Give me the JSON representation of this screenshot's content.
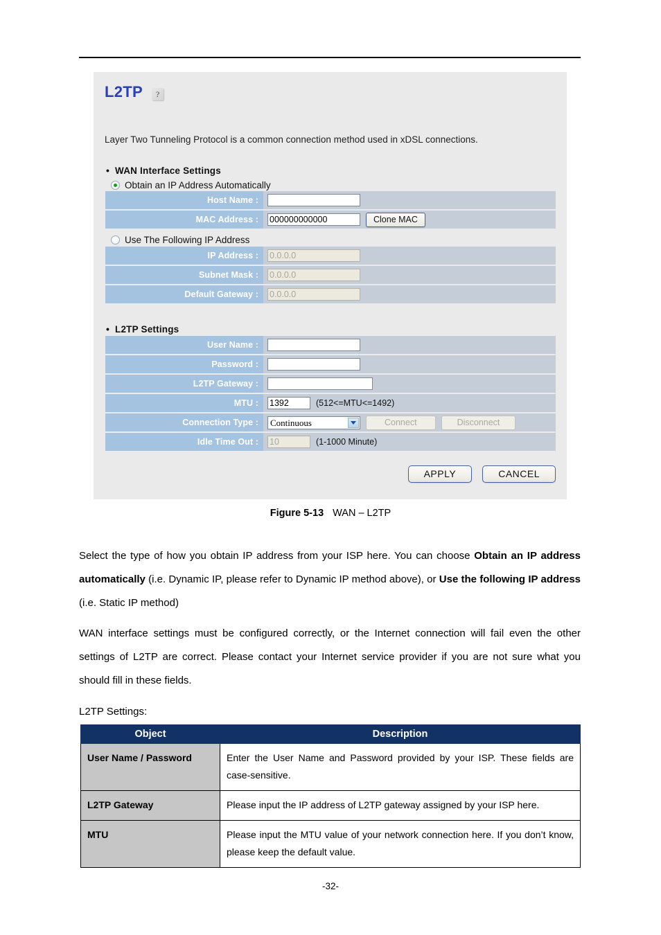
{
  "page": {
    "number": "-32-"
  },
  "screenshot": {
    "title": "L2TP",
    "help_icon": "?",
    "description": "Layer Two Tunneling Protocol is a common connection method used in xDSL connections.",
    "sections": {
      "wan": {
        "heading": "WAN Interface Settings",
        "radio_auto": "Obtain an IP Address Automatically",
        "radio_static": "Use The Following IP Address",
        "fields": [
          {
            "label": "Host Name :",
            "value": ""
          },
          {
            "label": "MAC Address :",
            "value": "000000000000",
            "button": "Clone MAC"
          },
          {
            "label": "IP Address :",
            "value": "0.0.0.0"
          },
          {
            "label": "Subnet Mask :",
            "value": "0.0.0.0"
          },
          {
            "label": "Default Gateway :",
            "value": "0.0.0.0"
          }
        ]
      },
      "l2tp": {
        "heading": "L2TP Settings",
        "fields": [
          {
            "label": "User Name :",
            "value": ""
          },
          {
            "label": "Password :",
            "value": ""
          },
          {
            "label": "L2TP Gateway :",
            "value": ""
          },
          {
            "label": "MTU :",
            "value": "1392",
            "hint": "(512<=MTU<=1492)"
          },
          {
            "label": "Connection Type :",
            "value": "Continuous",
            "btn_connect": "Connect",
            "btn_disconnect": "Disconnect"
          },
          {
            "label": "Idle Time Out :",
            "value": "10",
            "hint": "(1-1000 Minute)"
          }
        ],
        "connection_type_options": [
          "Continuous"
        ]
      }
    },
    "buttons": {
      "apply": "APPLY",
      "cancel": "CANCEL"
    },
    "colors": {
      "panel_bg": "#eaeaea",
      "label_cell": "#a4c3e0",
      "row_bg": "#c5cdd8",
      "title": "#2a3fb8",
      "radio_on": "#17a017"
    }
  },
  "figure": {
    "label": "Figure 5-13",
    "caption": "WAN – L2TP"
  },
  "body": {
    "para1_a": "Select the type of how you obtain IP address from your ISP here. You can choose ",
    "para1_b": "Obtain an IP address automatically",
    "para1_c": " (i.e. Dynamic IP, please refer to Dynamic IP method above), or ",
    "para1_d": "Use the following IP address",
    "para1_e": " (i.e. Static IP method)",
    "para2": "WAN interface settings must be configured correctly, or the Internet connection will fail even the other settings of L2TP are correct. Please contact your Internet service provider if you are not sure what you should fill in these fields.",
    "para3": "L2TP Settings:"
  },
  "table": {
    "headers": {
      "object": "Object",
      "description": "Description"
    },
    "header_color": "#123164",
    "rows": [
      {
        "object": "User Name / Password",
        "description": "Enter the User Name and Password provided by your ISP. These fields are case-sensitive."
      },
      {
        "object": "L2TP Gateway",
        "description": "Please input the IP address of L2TP gateway assigned by your ISP here."
      },
      {
        "object": "MTU",
        "description": "Please input the MTU value of your network connection here. If you don’t know, please keep the default value."
      }
    ]
  }
}
